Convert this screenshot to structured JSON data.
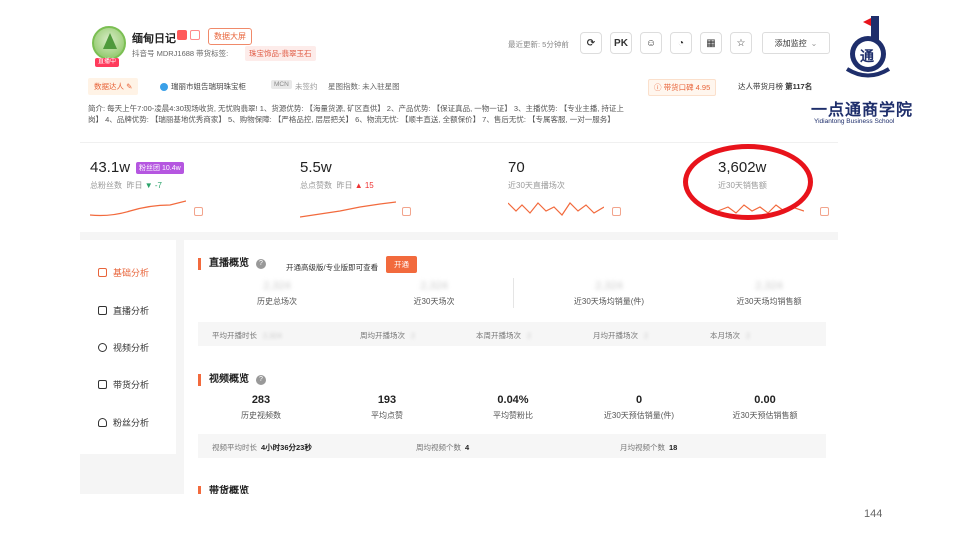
{
  "header": {
    "shop_name": "缅甸日记",
    "data_screen_label": "数据大屏",
    "live_tag": "直播中",
    "account_line": "抖音号 MDRJ1688 带货标签:",
    "category_tag": "珠宝饰品-翡翠玉石",
    "update_text": "最近更新: 5分钟前",
    "pk_label": "PK",
    "monitor_label": "添加监控"
  },
  "logo": {
    "name": "一点通商学院",
    "en": "Yidiantong Business School",
    "glyph": "通"
  },
  "tags": {
    "talent_label": "数据达人",
    "shop_ref": "瑞丽市姐告瑞玥珠宝柜",
    "mcn_label": "MCN",
    "mcn_value": "未签约",
    "star_index": "星图指数: 未入驻星图",
    "reputation": "带货口碑 4.95",
    "rank_label": "达人带货月榜",
    "rank_value": "第117名"
  },
  "intro": "简介: 每天上午7:00-凌晨4:30现场收货, 无忧购翡翠! 1、货源优势: 【海量货源, 矿区直供】 2、产品优势: 【保证真品, 一物一证】 3、主播优势: 【专业主播, 持证上岗】 4、品牌优势: 【瑞丽基地优秀商家】 5、购物保障: 【严格品控, 层层把关】 6、物流无忧: 【顺丰直送, 全额保价】 7、售后无忧: 【专属客服, 一对一服务】",
  "stats": [
    {
      "value": "43.1w",
      "label": "总粉丝数",
      "badge": "粉丝团 10.4w",
      "delta_prefix": "昨日",
      "delta": "▼ -7",
      "delta_dir": "down"
    },
    {
      "value": "5.5w",
      "label": "总点赞数",
      "delta_prefix": "昨日",
      "delta": "▲ 15",
      "delta_dir": "up"
    },
    {
      "value": "70",
      "label": "近30天直播场次"
    },
    {
      "value": "3,602w",
      "label": "近30天销售额"
    }
  ],
  "sidebar": {
    "items": [
      {
        "label": "基础分析",
        "active": true
      },
      {
        "label": "直播分析",
        "active": false
      },
      {
        "label": "视频分析",
        "active": false
      },
      {
        "label": "带货分析",
        "active": false
      },
      {
        "label": "粉丝分析",
        "active": false
      }
    ]
  },
  "live_overview": {
    "title": "直播概览",
    "hint": "开通高级版/专业版即可查看",
    "open_label": "开通",
    "metrics": [
      {
        "value": "2,324",
        "label": "历史总场次"
      },
      {
        "value": "2,324",
        "label": "近30天场次"
      },
      {
        "value": "2,324",
        "label": "近30天场均销量(件)"
      },
      {
        "value": "2,324",
        "label": "近30天场均销售额"
      }
    ],
    "sub": [
      {
        "label": "平均开播时长",
        "value": "2,324"
      },
      {
        "label": "周均开播场次",
        "value": "2"
      },
      {
        "label": "本周开播场次",
        "value": "2"
      },
      {
        "label": "月均开播场次",
        "value": "2"
      },
      {
        "label": "本月场次",
        "value": "2"
      }
    ]
  },
  "video_overview": {
    "title": "视频概览",
    "metrics": [
      {
        "value": "283",
        "label": "历史视频数"
      },
      {
        "value": "193",
        "label": "平均点赞"
      },
      {
        "value": "0.04%",
        "label": "平均赞粉比"
      },
      {
        "value": "0",
        "label": "近30天预估销量(件)"
      },
      {
        "value": "0.00",
        "label": "近30天预估销售额"
      }
    ],
    "sub": [
      {
        "label": "视频平均时长",
        "value": "4小时36分23秒"
      },
      {
        "label": "周均视频个数",
        "value": "4"
      },
      {
        "label": "月均视频个数",
        "value": "18"
      }
    ]
  },
  "goods_overview": {
    "title": "带货概览"
  },
  "page_number": "144"
}
